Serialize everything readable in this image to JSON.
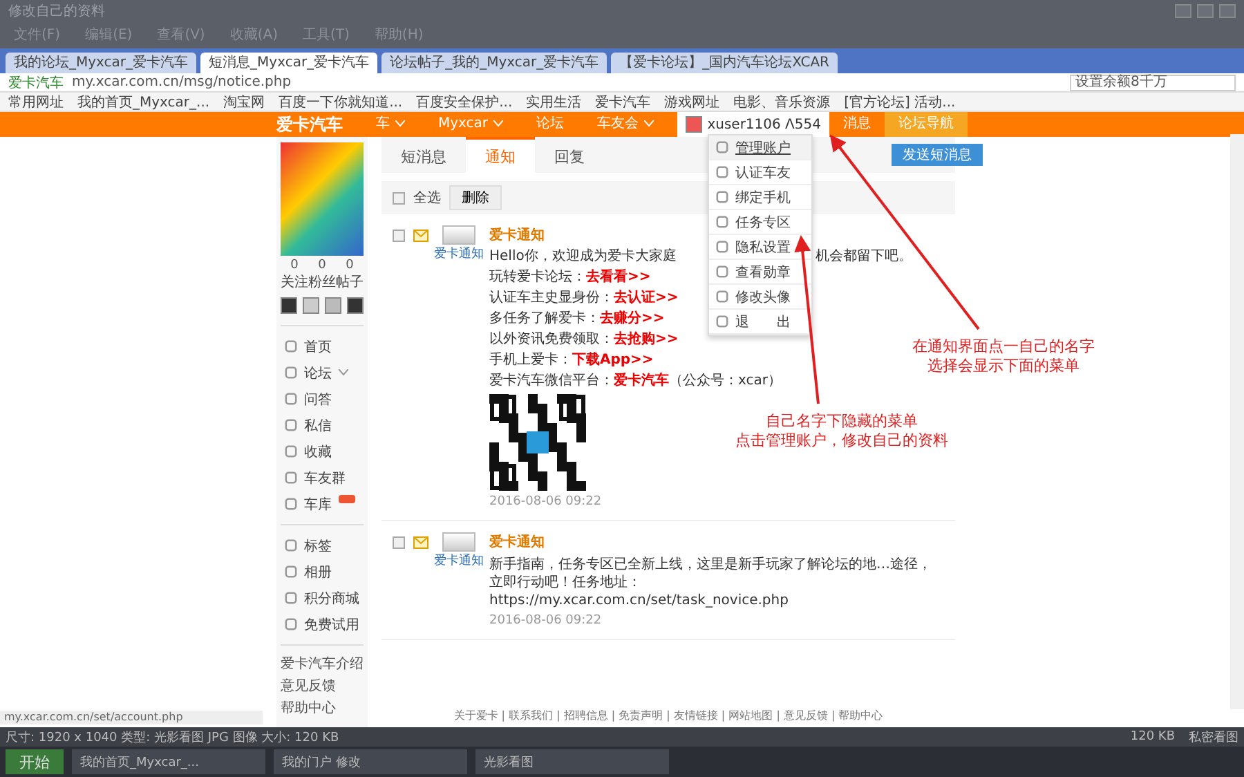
{
  "window": {
    "title": "修改自己的资料"
  },
  "menu": [
    "文件(F)",
    "编辑(E)",
    "查看(V)",
    "收藏(A)",
    "工具(T)",
    "帮助(H)"
  ],
  "browser_tabs": [
    {
      "label": "我的论坛_Myxcar_爱卡汽车",
      "selected": false
    },
    {
      "label": "短消息_Myxcar_爱卡汽车",
      "selected": true
    },
    {
      "label": "论坛帖子_我的_Myxcar_爱卡汽车",
      "selected": false
    },
    {
      "label": "【爱卡论坛】_国内汽车论坛XCAR",
      "selected": false
    }
  ],
  "address": {
    "site": "爱卡汽车",
    "url": "my.xcar.com.cn/msg/notice.php",
    "search": "设置余额8千万"
  },
  "bookmarks": [
    "常用网址",
    "我的首页_Myxcar_...",
    "淘宝网",
    "百度一下你就知道...",
    "百度安全保护...",
    "实用生活",
    "爱卡汽车",
    "游戏网址",
    "电影、音乐资源",
    "[官方论坛] 活动..."
  ],
  "site_nav": {
    "logo": "爱卡汽车",
    "items": [
      {
        "label": "车",
        "caret": true
      },
      {
        "label": "Myxcar",
        "caret": true
      },
      {
        "label": "论坛",
        "caret": false
      },
      {
        "label": "车友会",
        "caret": true
      }
    ],
    "user": "xuser1106 Λ554",
    "right": [
      {
        "label": "消息",
        "highlight": false
      },
      {
        "label": "论坛导航",
        "highlight": true
      }
    ]
  },
  "sidebar": {
    "stats": [
      {
        "count": "0",
        "label": "关注"
      },
      {
        "count": "0",
        "label": "粉丝"
      },
      {
        "count": "0",
        "label": "帖子"
      }
    ],
    "nav": [
      {
        "label": "首页",
        "expandable": false,
        "badge": false
      },
      {
        "label": "论坛",
        "expandable": true,
        "badge": false
      },
      {
        "label": "问答",
        "expandable": false,
        "badge": false
      },
      {
        "label": "私信",
        "expandable": false,
        "badge": false
      },
      {
        "label": "收藏",
        "expandable": false,
        "badge": false
      },
      {
        "label": "车友群",
        "expandable": false,
        "badge": false
      },
      {
        "label": "车库",
        "expandable": false,
        "badge": true
      }
    ],
    "nav2": [
      "标签",
      "相册",
      "积分商城",
      "免费试用"
    ],
    "links": [
      "爱卡汽车介绍",
      "意见反馈",
      "帮助中心"
    ]
  },
  "main": {
    "tabs": [
      {
        "label": "短消息",
        "selected": false
      },
      {
        "label": "通知",
        "selected": true
      },
      {
        "label": "回复",
        "selected": false
      }
    ],
    "send_button": "发送短消息",
    "select_all": {
      "label": "全选",
      "checked": false
    },
    "delete_button": "删除",
    "notices": [
      {
        "sender": "爱卡通知",
        "avatar_caption": "爱卡通知",
        "checked": false,
        "intro": "Hello你，欢迎成为爱卡大家庭",
        "intro_after": "机会都留下吧。",
        "lines": [
          {
            "text": "玩转爱卡论坛：",
            "link": "去看看>>"
          },
          {
            "text": "认证车主史显身份：",
            "link": "去认证>>"
          },
          {
            "text": "多任务了解爱卡：",
            "link": "去赚分>>"
          },
          {
            "text": "以外资讯免费领取：",
            "link": "去抢购>>"
          },
          {
            "text": "手机上爱卡：",
            "link": "下载App>>"
          },
          {
            "text": "爱卡汽车微信平台：",
            "link": "爱卡汽车",
            "suffix": "（公众号：xcar）"
          }
        ],
        "qr": true,
        "date": "2016-08-06 09:22"
      },
      {
        "sender": "爱卡通知",
        "avatar_caption": "爱卡通知",
        "checked": false,
        "intro": "新手指南，任务专区已全新上线，这里是新手玩家了解论坛的地…途径，立即行动吧！任务地址：https://my.xcar.com.cn/set/task_novice.php",
        "qr": false,
        "date": "2016-08-06 09:22"
      }
    ]
  },
  "dropdown": [
    {
      "label": "管理账户",
      "hover": true
    },
    {
      "label": "认证车友",
      "hover": false
    },
    {
      "label": "绑定手机",
      "hover": false
    },
    {
      "label": "任务专区",
      "hover": false
    },
    {
      "label": "隐私设置",
      "hover": false
    },
    {
      "label": "查看勋章",
      "hover": false
    },
    {
      "label": "修改头像",
      "hover": false
    },
    {
      "label": "退　　出",
      "hover": false
    }
  ],
  "annotations": [
    {
      "lines": [
        "在通知界面点一自己的名字",
        "选择会显示下面的菜单"
      ]
    },
    {
      "lines": [
        "自己名字下隐藏的菜单",
        "点击管理账户，修改自己的资料"
      ]
    }
  ],
  "footer": "关于爱卡 | 联系我们 | 招聘信息 | 免责声明 | 友情链接 | 网站地图 | 意见反馈 | 帮助中心",
  "status_url": "my.xcar.com.cn/set/account.php",
  "viewer_status": {
    "info": "尺寸: 1920 x 1040  类型: 光影看图 JPG 图像  大小: 120 KB",
    "size": "120 KB",
    "right": "私密看图"
  },
  "taskbar": {
    "start": "开始",
    "items": [
      "我的首页_Myxcar_...",
      "我的门户 修改",
      "光影看图"
    ]
  }
}
